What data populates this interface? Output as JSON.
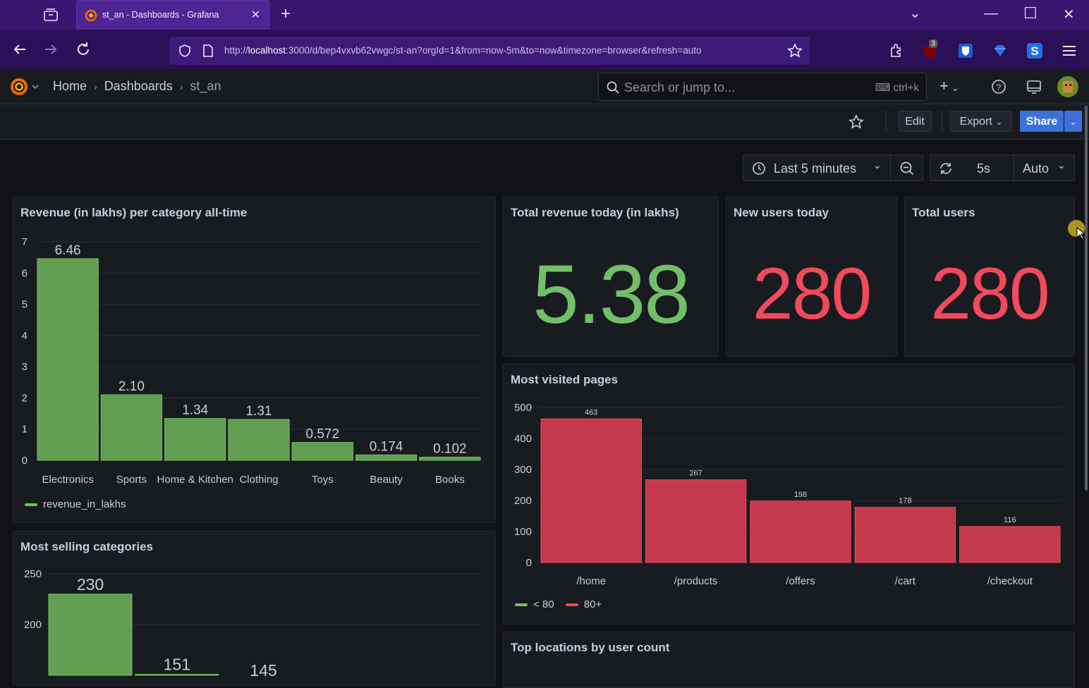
{
  "browser": {
    "tab_title": "st_an - Dashboards - Grafana",
    "url_host": "localhost",
    "url_prefix": "http://",
    "url_rest": ":3000/d/bep4vxvb62vwgc/st-an?orgId=1&from=now-5m&to=now&timezone=browser&refresh=auto",
    "ext_badge": "3"
  },
  "grafana": {
    "breadcrumbs": [
      "Home",
      "Dashboards",
      "st_an"
    ],
    "search_placeholder": "Search or jump to...",
    "search_shortcut": "ctrl+k",
    "toolbar": {
      "edit": "Edit",
      "export": "Export",
      "share": "Share"
    },
    "time_range": "Last 5 minutes",
    "refresh_interval": "5s",
    "refresh_mode": "Auto"
  },
  "panels": {
    "revenue_title": "Revenue (in lakhs) per category all-time",
    "revenue_legend": "revenue_in_lakhs",
    "total_revenue_title": "Total revenue today (in lakhs)",
    "total_revenue_value": "5.38",
    "new_users_title": "New users today",
    "new_users_value": "280",
    "total_users_title": "Total users",
    "total_users_value": "280",
    "visited_title": "Most visited pages",
    "visited_legend": [
      "< 80",
      "80+"
    ],
    "selling_title": "Most selling categories",
    "locations_title": "Top locations by user count"
  },
  "colors": {
    "green": "#73bf69",
    "red": "#f2495c",
    "bar_green": "#629e51",
    "bar_red": "#c4394c"
  },
  "chart_data": [
    {
      "type": "bar",
      "title": "Revenue (in lakhs) per category all-time",
      "categories": [
        "Electronics",
        "Sports",
        "Home & Kitchen",
        "Clothing",
        "Toys",
        "Beauty",
        "Books"
      ],
      "values": [
        6.46,
        2.1,
        1.34,
        1.31,
        0.572,
        0.174,
        0.102
      ],
      "labels": [
        "6.46",
        "2.10",
        "1.34",
        "1.31",
        "0.572",
        "0.174",
        "0.102"
      ],
      "yticks": [
        "0",
        "1",
        "2",
        "3",
        "4",
        "5",
        "6",
        "7"
      ],
      "ylim": [
        0,
        7
      ],
      "series": [
        {
          "name": "revenue_in_lakhs"
        }
      ]
    },
    {
      "type": "bar",
      "title": "Most visited pages",
      "categories": [
        "/home",
        "/products",
        "/offers",
        "/cart",
        "/checkout"
      ],
      "values": [
        463,
        267,
        198,
        178,
        116
      ],
      "labels": [
        "463",
        "267",
        "198",
        "178",
        "116"
      ],
      "yticks": [
        "0",
        "100",
        "200",
        "300",
        "400",
        "500"
      ],
      "ylim": [
        0,
        500
      ]
    },
    {
      "type": "bar",
      "title": "Most selling categories",
      "values": [
        230,
        151,
        145
      ],
      "labels": [
        "230",
        "151",
        "145"
      ],
      "yticks": [
        "200",
        "250"
      ],
      "ylim": [
        150,
        250
      ]
    }
  ]
}
